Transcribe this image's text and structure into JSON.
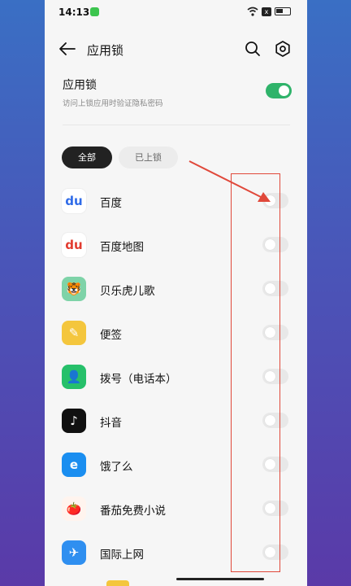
{
  "status_bar": {
    "time": "14:13",
    "sim_label": "x"
  },
  "header": {
    "title": "应用锁"
  },
  "master": {
    "title": "应用锁",
    "subtitle": "访问上锁应用时验证隐私密码",
    "enabled": true
  },
  "tabs": [
    {
      "label": "全部",
      "active": true
    },
    {
      "label": "已上锁",
      "active": false
    }
  ],
  "apps": [
    {
      "name": "百度",
      "icon": "baidu-icon",
      "icon_glyph": "du",
      "color": "#2f6be8",
      "bg": "#ffffff",
      "locked": false
    },
    {
      "name": "百度地图",
      "icon": "baidu-map-icon",
      "icon_glyph": "du",
      "color": "#e23b2f",
      "bg": "#ffffff",
      "locked": false
    },
    {
      "name": "贝乐虎儿歌",
      "icon": "tiger-icon",
      "icon_glyph": "🐯",
      "color": "#f2a02a",
      "bg": "#7ed3a8",
      "locked": false
    },
    {
      "name": "便签",
      "icon": "notes-icon",
      "icon_glyph": "✎",
      "color": "#ffffff",
      "bg": "#f4c63d",
      "locked": false
    },
    {
      "name": "拨号（电话本）",
      "icon": "phone-contacts-icon",
      "icon_glyph": "👤",
      "color": "#ffffff",
      "bg": "#26c06a",
      "locked": false
    },
    {
      "name": "抖音",
      "icon": "douyin-icon",
      "icon_glyph": "♪",
      "color": "#ffffff",
      "bg": "#111111",
      "locked": false
    },
    {
      "name": "饿了么",
      "icon": "eleme-icon",
      "icon_glyph": "e",
      "color": "#ffffff",
      "bg": "#1a8ef0",
      "locked": false
    },
    {
      "name": "番茄免费小说",
      "icon": "tomato-novel-icon",
      "icon_glyph": "🍅",
      "color": "#e8452f",
      "bg": "#fff4ee",
      "locked": false
    },
    {
      "name": "国际上网",
      "icon": "airplane-icon",
      "icon_glyph": "✈",
      "color": "#ffffff",
      "bg": "#2f8ff0",
      "locked": false
    }
  ],
  "annotation": {
    "color": "#e0483a"
  }
}
